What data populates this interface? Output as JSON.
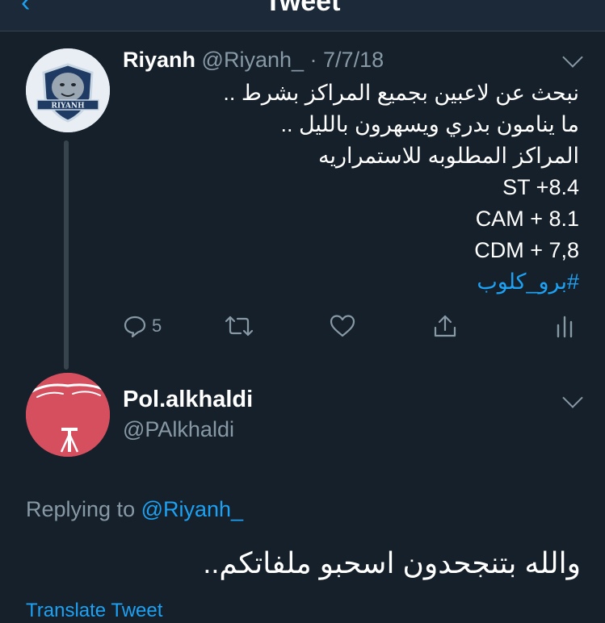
{
  "header": {
    "title": "Tweet",
    "back_glyph": "‹"
  },
  "tweet": {
    "author_name": "Riyanh",
    "author_handle": "@Riyanh_",
    "separator": " · ",
    "date": "7/7/18",
    "avatar_icon": "riyanh-logo",
    "avatar_label": "RIYANH",
    "lines": [
      "نبحث عن لاعبين بجميع المراكز بشرط ..",
      "ما ينامون بدري ويسهرون بالليل ..",
      "المراكز المطلوبه للاستمراريه"
    ],
    "stats": [
      "ST +8.4",
      "CAM + 8.1",
      "CDM + 7,8"
    ],
    "hashtag": "#برو_كلوب",
    "actions": {
      "reply_count": "5",
      "reply_icon": "reply-icon",
      "retweet_icon": "retweet-icon",
      "like_icon": "like-icon",
      "share_icon": "share-icon",
      "analytics_icon": "analytics-icon"
    }
  },
  "reply": {
    "author_name": "Pol.alkhaldi",
    "author_handle": "@PAlkhaldi",
    "avatar_icon": "flag-avatar",
    "replying_prefix": "Replying to ",
    "replying_mention": "@Riyanh_",
    "text": "والله بتنجحدون اسحبو ملفاتكم..",
    "translate_label": "Translate Tweet"
  },
  "colors": {
    "background": "#15202b",
    "accent": "#1da1f2",
    "muted": "#8899a6",
    "divider": "#38444d"
  }
}
